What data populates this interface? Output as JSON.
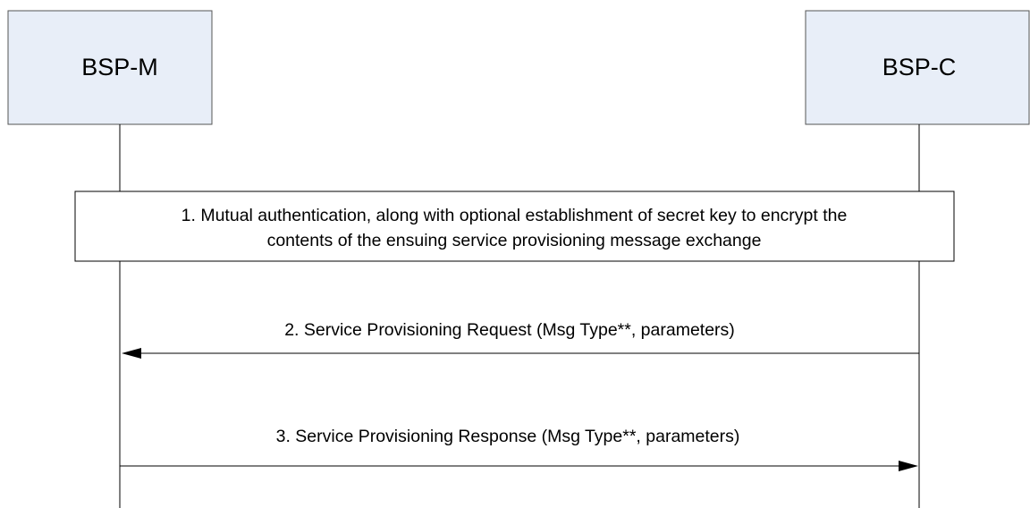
{
  "participants": [
    {
      "id": "bsp-m",
      "label": "BSP-M"
    },
    {
      "id": "bsp-c",
      "label": "BSP-C"
    }
  ],
  "steps": [
    {
      "kind": "box",
      "lines": [
        "1.  Mutual authentication, along with  optional establishment of secret key to encrypt the",
        "contents of the ensuing service provisioning message exchange"
      ]
    },
    {
      "kind": "message",
      "from": "BSP-C",
      "to": "BSP-M",
      "label": "2.  Service Provisioning Request (Msg Type**, parameters)"
    },
    {
      "kind": "message",
      "from": "BSP-M",
      "to": "BSP-C",
      "label": "3.  Service Provisioning Response (Msg Type**, parameters)"
    }
  ],
  "colors": {
    "participant_fill": "#e8eef8",
    "stroke": "#000000",
    "participant_border": "#555555"
  }
}
